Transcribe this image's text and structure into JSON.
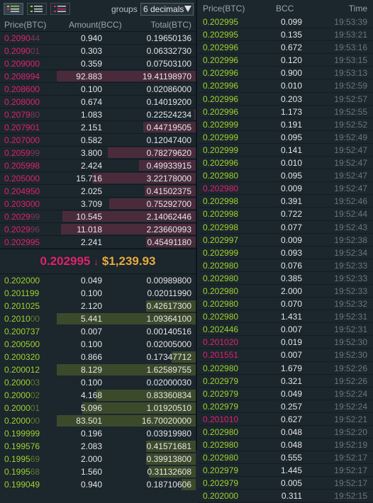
{
  "orderbook": {
    "groups_label": "groups",
    "groups_value": "6 decimals",
    "headers": {
      "price": "Price(BTC)",
      "amount": "Amount(BCC)",
      "total": "Total(BTC)"
    },
    "asks": [
      {
        "pm": "0.2090",
        "pd": "44",
        "amount": "0.940",
        "total": "0.19650136",
        "depth": 0.0
      },
      {
        "pm": "0.2090",
        "pd": "01",
        "amount": "0.303",
        "total": "0.06332730",
        "depth": 0.0
      },
      {
        "pm": "0.209000",
        "pd": "",
        "amount": "0.359",
        "total": "0.07503100",
        "depth": 0.0
      },
      {
        "pm": "0.208994",
        "pd": "",
        "amount": "92.883",
        "total": "19.41198970",
        "depth": 0.98
      },
      {
        "pm": "0.208600",
        "pd": "",
        "amount": "0.100",
        "total": "0.02086000",
        "depth": 0.0
      },
      {
        "pm": "0.208000",
        "pd": "",
        "amount": "0.674",
        "total": "0.14019200",
        "depth": 0.0
      },
      {
        "pm": "0.2079",
        "pd": "80",
        "amount": "1.083",
        "total": "0.22524234",
        "depth": 0.01
      },
      {
        "pm": "0.207901",
        "pd": "",
        "amount": "2.151",
        "total": "0.44719505",
        "depth": 0.37
      },
      {
        "pm": "0.207000",
        "pd": "",
        "amount": "0.582",
        "total": "0.12047400",
        "depth": 0.0
      },
      {
        "pm": "0.2059",
        "pd": "99",
        "amount": "3.800",
        "total": "0.78279620",
        "depth": 0.62
      },
      {
        "pm": "0.205998",
        "pd": "",
        "amount": "2.424",
        "total": "0.49933915",
        "depth": 0.4
      },
      {
        "pm": "0.205000",
        "pd": "",
        "amount": "15.716",
        "total": "3.22178000",
        "depth": 0.73
      },
      {
        "pm": "0.204950",
        "pd": "",
        "amount": "2.025",
        "total": "0.41502375",
        "depth": 0.36
      },
      {
        "pm": "0.203000",
        "pd": "",
        "amount": "3.709",
        "total": "0.75292700",
        "depth": 0.61
      },
      {
        "pm": "0.2029",
        "pd": "99",
        "amount": "10.545",
        "total": "2.14062446",
        "depth": 0.94
      },
      {
        "pm": "0.2029",
        "pd": "96",
        "amount": "11.018",
        "total": "2.23660993",
        "depth": 0.95
      },
      {
        "pm": "0.202995",
        "pd": "",
        "amount": "2.241",
        "total": "0.45491180",
        "depth": 0.35
      }
    ],
    "last_price": "0.202995",
    "last_arrow": "↓",
    "last_usd": "$1,239.93",
    "bids": [
      {
        "pm": "0.202000",
        "pd": "",
        "amount": "0.049",
        "total": "0.00989800",
        "depth": 0.0
      },
      {
        "pm": "0.201199",
        "pd": "",
        "amount": "0.100",
        "total": "0.02011990",
        "depth": 0.0
      },
      {
        "pm": "0.201025",
        "pd": "",
        "amount": "2.120",
        "total": "0.42617300",
        "depth": 0.35
      },
      {
        "pm": "0.2010",
        "pd": "00",
        "amount": "5.441",
        "total": "1.09364100",
        "depth": 0.98
      },
      {
        "pm": "0.200737",
        "pd": "",
        "amount": "0.007",
        "total": "0.00140516",
        "depth": 0.0
      },
      {
        "pm": "0.200500",
        "pd": "",
        "amount": "0.100",
        "total": "0.02005000",
        "depth": 0.0
      },
      {
        "pm": "0.200320",
        "pd": "",
        "amount": "0.866",
        "total": "0.17347712",
        "depth": 0.17
      },
      {
        "pm": "0.200012",
        "pd": "",
        "amount": "8.129",
        "total": "1.62589755",
        "depth": 0.98
      },
      {
        "pm": "0.2000",
        "pd": "03",
        "amount": "0.100",
        "total": "0.02000030",
        "depth": 0.0
      },
      {
        "pm": "0.2000",
        "pd": "02",
        "amount": "4.168",
        "total": "0.83360834",
        "depth": 0.7
      },
      {
        "pm": "0.2000",
        "pd": "01",
        "amount": "5.096",
        "total": "1.01920510",
        "depth": 0.8
      },
      {
        "pm": "0.2000",
        "pd": "00",
        "amount": "83.501",
        "total": "16.70020000",
        "depth": 0.98
      },
      {
        "pm": "0.199999",
        "pd": "",
        "amount": "0.196",
        "total": "0.03919980",
        "depth": 0.0
      },
      {
        "pm": "0.199576",
        "pd": "",
        "amount": "2.083",
        "total": "0.41571681",
        "depth": 0.35
      },
      {
        "pm": "0.1995",
        "pd": "69",
        "amount": "2.000",
        "total": "0.39913800",
        "depth": 0.35
      },
      {
        "pm": "0.1995",
        "pd": "68",
        "amount": "1.560",
        "total": "0.31132608",
        "depth": 0.33
      },
      {
        "pm": "0.199049",
        "pd": "",
        "amount": "0.940",
        "total": "0.18710606",
        "depth": 0.1
      }
    ]
  },
  "trades": {
    "headers": {
      "price": "Price(BTC)",
      "amount": "BCC",
      "time": "Time"
    },
    "rows": [
      {
        "side": "buy",
        "price": "0.202995",
        "amount": "0.099",
        "time": "19:53:39"
      },
      {
        "side": "buy",
        "price": "0.202995",
        "amount": "0.135",
        "time": "19:53:21"
      },
      {
        "side": "buy",
        "price": "0.202996",
        "amount": "0.672",
        "time": "19:53:16"
      },
      {
        "side": "buy",
        "price": "0.202996",
        "amount": "0.120",
        "time": "19:53:15"
      },
      {
        "side": "buy",
        "price": "0.202996",
        "amount": "0.900",
        "time": "19:53:13"
      },
      {
        "side": "buy",
        "price": "0.202996",
        "amount": "0.010",
        "time": "19:52:59"
      },
      {
        "side": "buy",
        "price": "0.202996",
        "amount": "0.203",
        "time": "19:52:57"
      },
      {
        "side": "buy",
        "price": "0.202996",
        "amount": "1.173",
        "time": "19:52:55"
      },
      {
        "side": "buy",
        "price": "0.202999",
        "amount": "0.191",
        "time": "19:52:52"
      },
      {
        "side": "buy",
        "price": "0.202999",
        "amount": "0.095",
        "time": "19:52:49"
      },
      {
        "side": "buy",
        "price": "0.202999",
        "amount": "0.141",
        "time": "19:52:47"
      },
      {
        "side": "buy",
        "price": "0.202996",
        "amount": "0.010",
        "time": "19:52:47"
      },
      {
        "side": "buy",
        "price": "0.202980",
        "amount": "0.095",
        "time": "19:52:47"
      },
      {
        "side": "sell",
        "price": "0.202980",
        "amount": "0.009",
        "time": "19:52:47"
      },
      {
        "side": "buy",
        "price": "0.202998",
        "amount": "0.391",
        "time": "19:52:46"
      },
      {
        "side": "buy",
        "price": "0.202998",
        "amount": "0.722",
        "time": "19:52:44"
      },
      {
        "side": "buy",
        "price": "0.202998",
        "amount": "0.077",
        "time": "19:52:43"
      },
      {
        "side": "buy",
        "price": "0.202997",
        "amount": "0.009",
        "time": "19:52:38"
      },
      {
        "side": "buy",
        "price": "0.202999",
        "amount": "0.093",
        "time": "19:52:34"
      },
      {
        "side": "buy",
        "price": "0.202980",
        "amount": "0.076",
        "time": "19:52:33"
      },
      {
        "side": "buy",
        "price": "0.202980",
        "amount": "0.385",
        "time": "19:52:33"
      },
      {
        "side": "buy",
        "price": "0.202980",
        "amount": "2.000",
        "time": "19:52:33"
      },
      {
        "side": "buy",
        "price": "0.202980",
        "amount": "0.070",
        "time": "19:52:32"
      },
      {
        "side": "buy",
        "price": "0.202980",
        "amount": "1.431",
        "time": "19:52:31"
      },
      {
        "side": "buy",
        "price": "0.202446",
        "amount": "0.007",
        "time": "19:52:31"
      },
      {
        "side": "sell",
        "price": "0.201020",
        "amount": "0.019",
        "time": "19:52:30"
      },
      {
        "side": "sell",
        "price": "0.201551",
        "amount": "0.007",
        "time": "19:52:30"
      },
      {
        "side": "buy",
        "price": "0.202980",
        "amount": "1.679",
        "time": "19:52:26"
      },
      {
        "side": "buy",
        "price": "0.202979",
        "amount": "0.321",
        "time": "19:52:26"
      },
      {
        "side": "buy",
        "price": "0.202979",
        "amount": "0.049",
        "time": "19:52:24"
      },
      {
        "side": "buy",
        "price": "0.202979",
        "amount": "0.257",
        "time": "19:52:24"
      },
      {
        "side": "sell",
        "price": "0.201010",
        "amount": "0.627",
        "time": "19:52:21"
      },
      {
        "side": "buy",
        "price": "0.202980",
        "amount": "0.048",
        "time": "19:52:20"
      },
      {
        "side": "buy",
        "price": "0.202980",
        "amount": "0.048",
        "time": "19:52:19"
      },
      {
        "side": "buy",
        "price": "0.202980",
        "amount": "0.555",
        "time": "19:52:17"
      },
      {
        "side": "buy",
        "price": "0.202979",
        "amount": "1.445",
        "time": "19:52:17"
      },
      {
        "side": "buy",
        "price": "0.202979",
        "amount": "0.005",
        "time": "19:52:17"
      },
      {
        "side": "buy",
        "price": "0.202000",
        "amount": "0.311",
        "time": "19:52:15"
      }
    ]
  },
  "colors": {
    "ask": "#e0216f",
    "bid": "#9fd42a",
    "usd": "#e9a93b",
    "bg": "#1b262d"
  }
}
